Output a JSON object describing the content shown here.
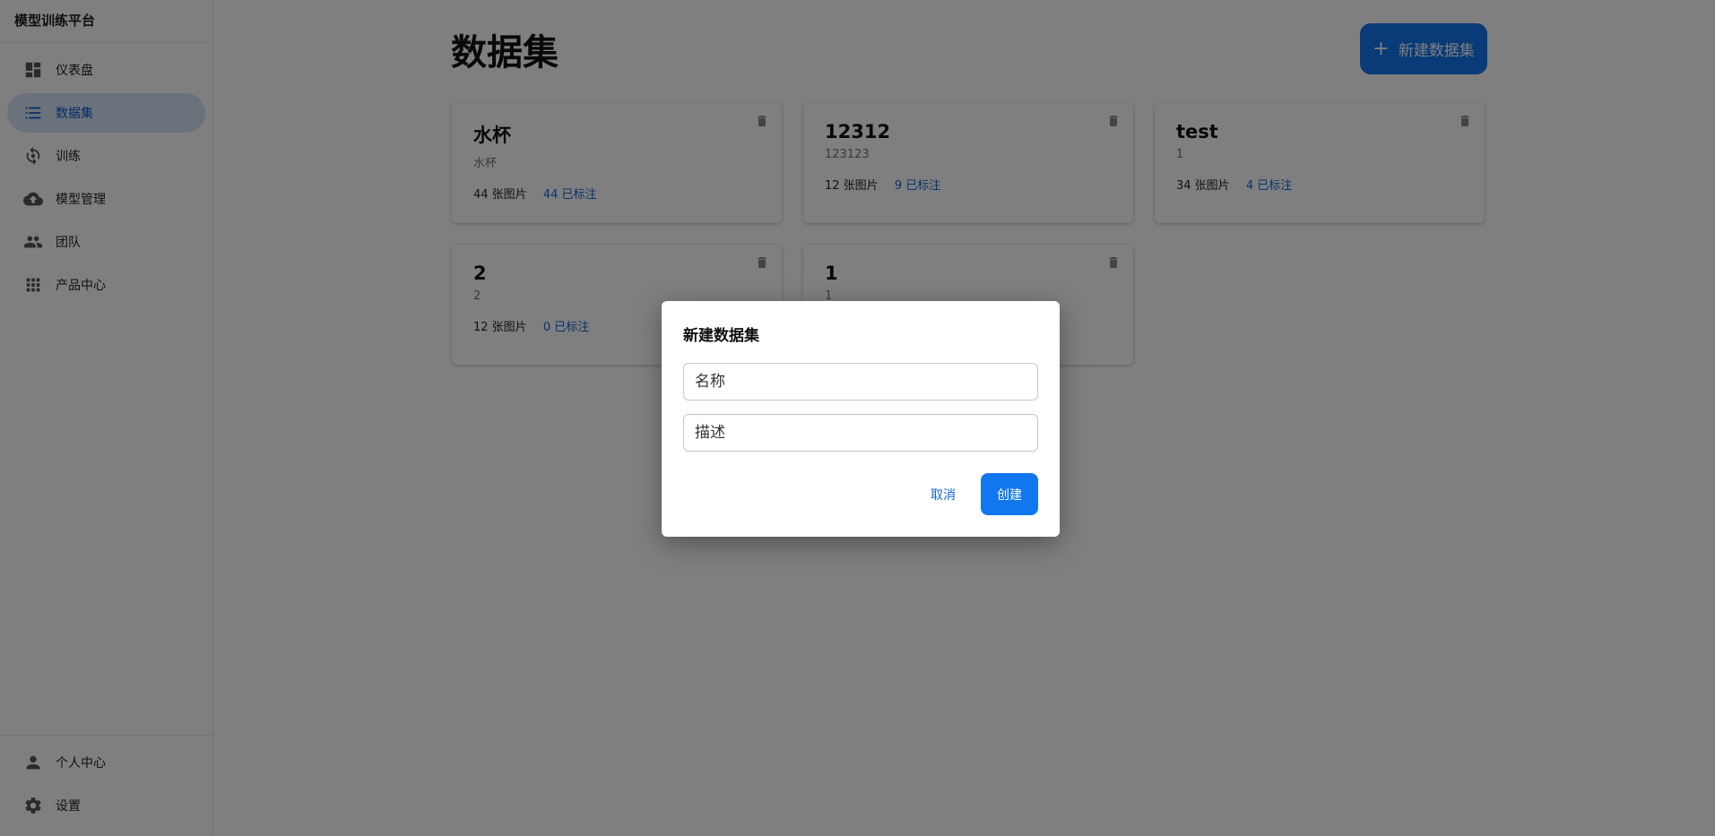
{
  "app": {
    "title": "模型训练平台"
  },
  "sidebar": {
    "items": [
      {
        "label": "仪表盘",
        "icon": "dashboard-icon"
      },
      {
        "label": "数据集",
        "icon": "dataset-list-icon",
        "active": true
      },
      {
        "label": "训练",
        "icon": "training-icon"
      },
      {
        "label": "模型管理",
        "icon": "cloud-upload-icon"
      },
      {
        "label": "团队",
        "icon": "team-icon"
      },
      {
        "label": "产品中心",
        "icon": "apps-grid-icon"
      }
    ],
    "bottom_items": [
      {
        "label": "个人中心",
        "icon": "person-icon"
      },
      {
        "label": "设置",
        "icon": "gear-icon"
      }
    ]
  },
  "main": {
    "title": "数据集",
    "new_button": {
      "icon": "+",
      "label": "新建数据集"
    }
  },
  "datasets": [
    {
      "name": "水杯",
      "description": "水杯",
      "images": "44 张图片",
      "labeled": "44 已标注"
    },
    {
      "name": "12312",
      "description": "123123",
      "images": "12 张图片",
      "labeled": "9 已标注"
    },
    {
      "name": "test",
      "description": "1",
      "images": "34 张图片",
      "labeled": "4 已标注"
    },
    {
      "name": "2",
      "description": "2",
      "images": "12 张图片",
      "labeled": "0 已标注"
    },
    {
      "name": "1",
      "description": "1",
      "images": "",
      "labeled": ""
    }
  ],
  "dialog": {
    "title": "新建数据集",
    "name_placeholder": "名称",
    "description_placeholder": "描述",
    "cancel_label": "取消",
    "create_label": "创建"
  },
  "colors": {
    "accent": "#1177ee",
    "active_nav_bg": "#d6e4f7",
    "link": "#1166dd",
    "overlay": "rgba(0,0,0,0.5)"
  }
}
